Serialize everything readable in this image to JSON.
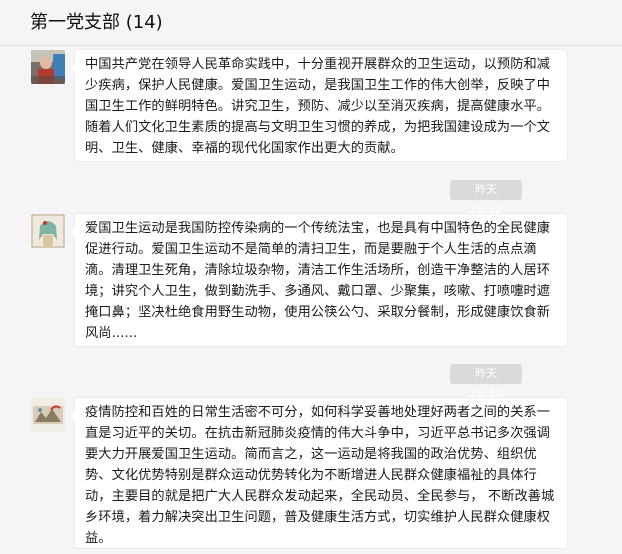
{
  "header": {
    "title": "第一党支部 (14)"
  },
  "messages": [
    {
      "text": "中国共产党在领导人民革命实践中，十分重视开展群众的卫生运动，以预防和减少疾病，保护人民健康。爱国卫生运动，是我国卫生工作的伟大创举，反映了中国卫生工作的鲜明特色。讲究卫生，预防、减少以至消灭疾病，提高健康水平。随着人们文化卫生素质的提高与文明卫生习惯的养成，为把我国建设成为一个文明、卫生、健康、幸福的现代化国家作出更大的贡献。"
    },
    {
      "time": "昨天 22:12",
      "text": "爱国卫生运动是我国防控传染病的一个传统法宝，也是具有中国特色的全民健康促进行动。爱国卫生运动不是简单的清扫卫生，而是要融于个人生活的点点滴滴。清理卫生死角，清除垃圾杂物，清洁工作生活场所，创造干净整洁的人居环境；讲究个人卫生，做到勤洗手、多通风、戴口罩、少聚集，咳嗽、打喷嚏时遮掩口鼻；坚决杜绝食用野生动物，使用公筷公勺、采取分餐制，形成健康饮食新风尚......"
    },
    {
      "time": "昨天 22:30",
      "text": "疫情防控和百姓的日常生活密不可分，如何科学妥善地处理好两者之间的关系一直是习近平的关切。在抗击新冠肺炎疫情的伟大斗争中，习近平总书记多次强调要大力开展爱国卫生运动。简而言之，这一运动是将我国的政治优势、组织优势、文化优势特别是群众运动优势转化为不断增进人民群众健康福祉的具体行动，主要目的就是把广大人民群众发动起来，全民动员、全民参与， 不断改善城乡环境，着力解决突出卫生问题，普及健康生活方式，切实维护人民群众健康权益。"
    }
  ]
}
